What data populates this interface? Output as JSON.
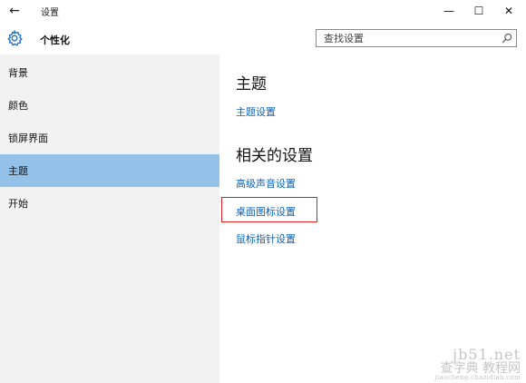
{
  "titlebar": {
    "title": "设置",
    "back_glyph": "←",
    "minimize_glyph": "—",
    "maximize_glyph": "☐",
    "close_glyph": "✕"
  },
  "header": {
    "icon": "gear-icon",
    "title": "个性化",
    "search": {
      "placeholder": "查找设置",
      "value": ""
    }
  },
  "sidebar": {
    "selected_index": 3,
    "items": [
      {
        "label": "背景"
      },
      {
        "label": "颜色"
      },
      {
        "label": "锁屏界面"
      },
      {
        "label": "主题"
      },
      {
        "label": "开始"
      }
    ]
  },
  "content": {
    "sections": [
      {
        "heading": "主题",
        "links": [
          {
            "label": "主题设置"
          }
        ]
      },
      {
        "heading": "相关的设置",
        "links": [
          {
            "label": "高级声音设置"
          },
          {
            "label": "桌面图标设置",
            "highlighted": true
          },
          {
            "label": "鼠标指针设置"
          }
        ]
      }
    ]
  },
  "watermark": {
    "line1": "jb51.net",
    "line2": "查字典 教程网",
    "line3": "jiaocheng.chazidian.com"
  },
  "colors": {
    "accent_link": "#0a62b8",
    "sidebar_bg": "#f2f2f2",
    "sidebar_selected": "#94c1e8",
    "highlight_border": "#e02020",
    "gear_icon": "#1e6fc4"
  }
}
